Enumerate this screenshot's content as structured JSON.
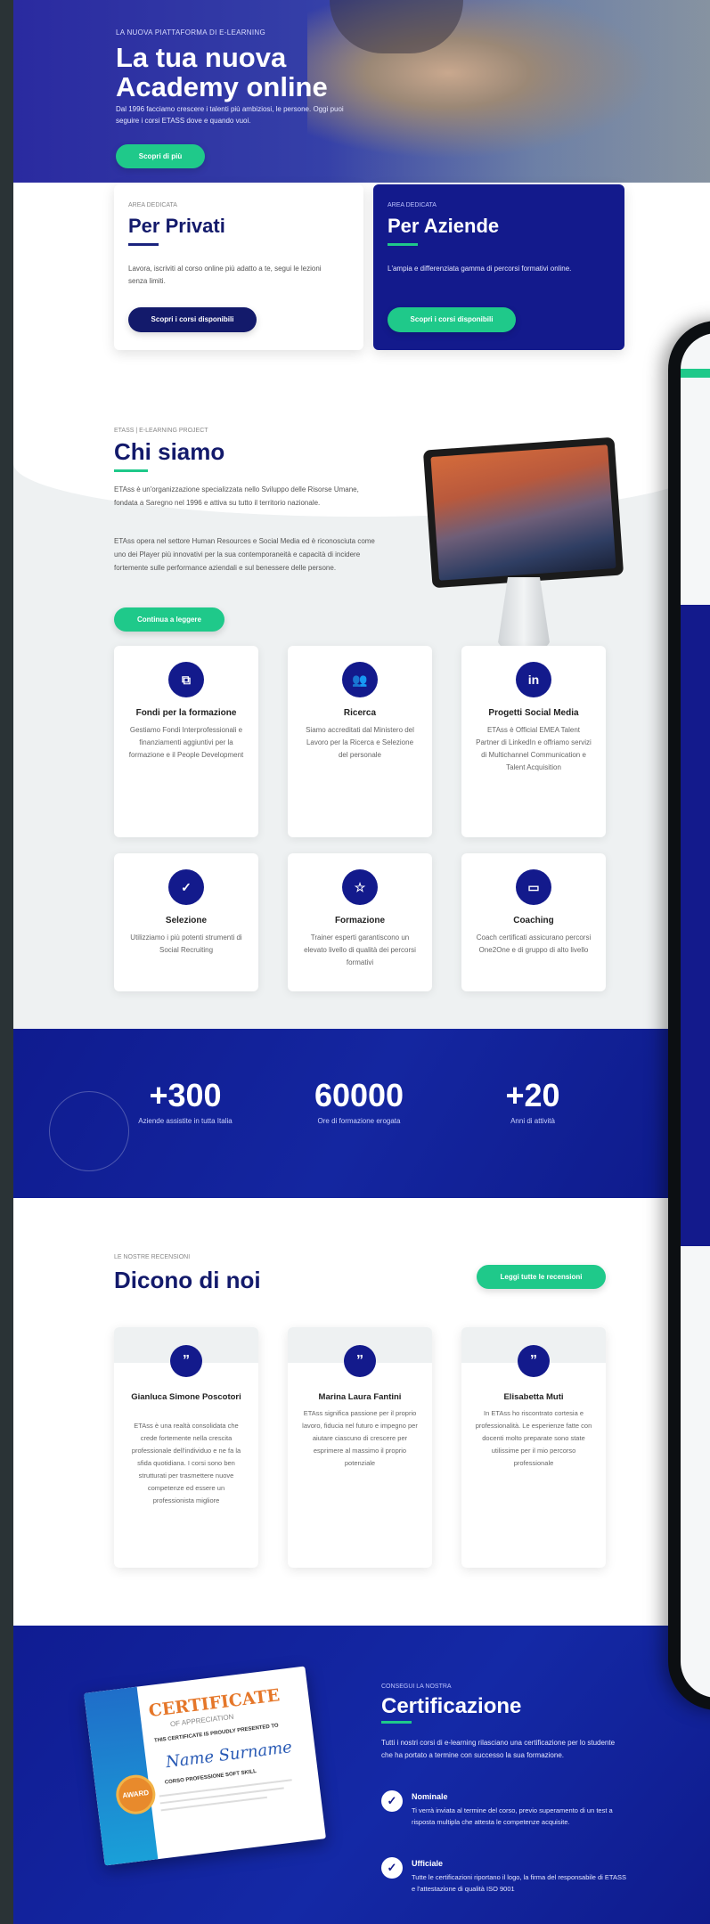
{
  "hero": {
    "kicker": "LA NUOVA PIATTAFORMA DI E-LEARNING",
    "title": "La tua nuova Academy online",
    "desc": "Dal 1996 facciamo crescere i talenti più ambiziosi, le persone. Oggi puoi seguire i corsi ETASS dove e quando vuoi.",
    "button": "Scopri di più"
  },
  "privati": {
    "kicker": "AREA DEDICATA",
    "title": "Per Privati",
    "text": "Lavora, iscriviti al corso online più adatto a te, segui le lezioni senza limiti.",
    "button": "Scopri i corsi disponibili"
  },
  "aziende": {
    "kicker": "AREA DEDICATA",
    "title": "Per Aziende",
    "text": "L'ampia e differenziata gamma di percorsi formativi online.",
    "button": "Scopri i corsi disponibili"
  },
  "about": {
    "kicker": "ETASS | E-LEARNING PROJECT",
    "title": "Chi siamo",
    "p1": "ETAss è un'organizzazione specializzata nello Sviluppo delle Risorse Umane, fondata a Saregno nel 1996 e attiva su tutto il territorio nazionale.",
    "p2": "ETAss opera nel settore Human Resources e Social Media ed è riconosciuta come uno dei Player più innovativi per la sua contemporaneità e capacità di incidere fortemente sulle performance aziendali e sul benessere delle persone.",
    "button": "Continua a leggere"
  },
  "features": [
    {
      "icon": "document-icon",
      "glyph": "⧉",
      "title": "Fondi per la formazione",
      "text": "Gestiamo Fondi Interprofessionali e finanziamenti aggiuntivi per la formazione e il People Development"
    },
    {
      "icon": "people-icon",
      "glyph": "👥",
      "title": "Ricerca",
      "text": "Siamo accreditati dal Ministero del Lavoro per la Ricerca e Selezione del personale"
    },
    {
      "icon": "linkedin-icon",
      "glyph": "in",
      "title": "Progetti Social Media",
      "text": "ETAss è Official EMEA Talent Partner di LinkedIn e offriamo servizi di Multichannel Communication e Talent Acquisition"
    },
    {
      "icon": "check-icon",
      "glyph": "✓",
      "title": "Selezione",
      "text": "Utilizziamo i più potenti strumenti di Social Recruiting"
    },
    {
      "icon": "star-icon",
      "glyph": "☆",
      "title": "Formazione",
      "text": "Trainer esperti garantiscono un elevato livello di qualità dei percorsi formativi"
    },
    {
      "icon": "card-icon",
      "glyph": "▭",
      "title": "Coaching",
      "text": "Coach certificati assicurano percorsi One2One e di gruppo di alto livello"
    }
  ],
  "stats": [
    {
      "number": "+300",
      "label": "Aziende assistite in tutta Italia"
    },
    {
      "number": "60000",
      "label": "Ore di formazione erogata"
    },
    {
      "number": "+20",
      "label": "Anni di attività"
    }
  ],
  "reviews": {
    "kicker": "LE NOSTRE RECENSIONI",
    "title": "Dicono di noi",
    "button": "Leggi tutte le recensioni",
    "items": [
      {
        "name": "Gianluca Simone Poscotori",
        "text": "ETAss è una realtà consolidata che crede fortemente nella crescita professionale dell'individuo e ne fa la sfida quotidiana. I corsi sono ben strutturati per trasmettere nuove competenze ed essere un professionista migliore"
      },
      {
        "name": "Marina Laura Fantini",
        "text": "ETAss significa passione per il proprio lavoro, fiducia nel futuro e impegno per aiutare ciascuno di crescere per esprimere al massimo il proprio potenziale"
      },
      {
        "name": "Elisabetta Muti",
        "text": "In ETAss ho riscontrato cortesia e professionalità. Le esperienze fatte con docenti molto preparate sono state utilissime per il mio percorso professionale"
      }
    ]
  },
  "cert": {
    "kicker": "CONSEGUI LA NOSTRA",
    "title": "Certificazione",
    "text": "Tutti i nostri corsi di e-learning rilasciano una certificazione per lo studente che ha portato a termine con successo la sua formazione.",
    "items": [
      {
        "title": "Nominale",
        "text": "Ti verrà inviata al termine del corso, previo superamento di un test a risposta multipla che attesta le competenze acquisite."
      },
      {
        "title": "Ufficiale",
        "text": "Tutte le certificazioni riportano il logo, la firma del responsabile di ETASS e l'attestazione di qualità ISO 9001"
      }
    ],
    "image": {
      "heading": "CERTIFICATE",
      "sub": "OF APPRECIATION",
      "line1": "THIS CERTIFICATE IS PROUDLY PRESENTED TO",
      "name": "Name Surname",
      "line2": "CORSO PROFESSIONE SOFT SKILL",
      "badge": "AWARD"
    }
  }
}
